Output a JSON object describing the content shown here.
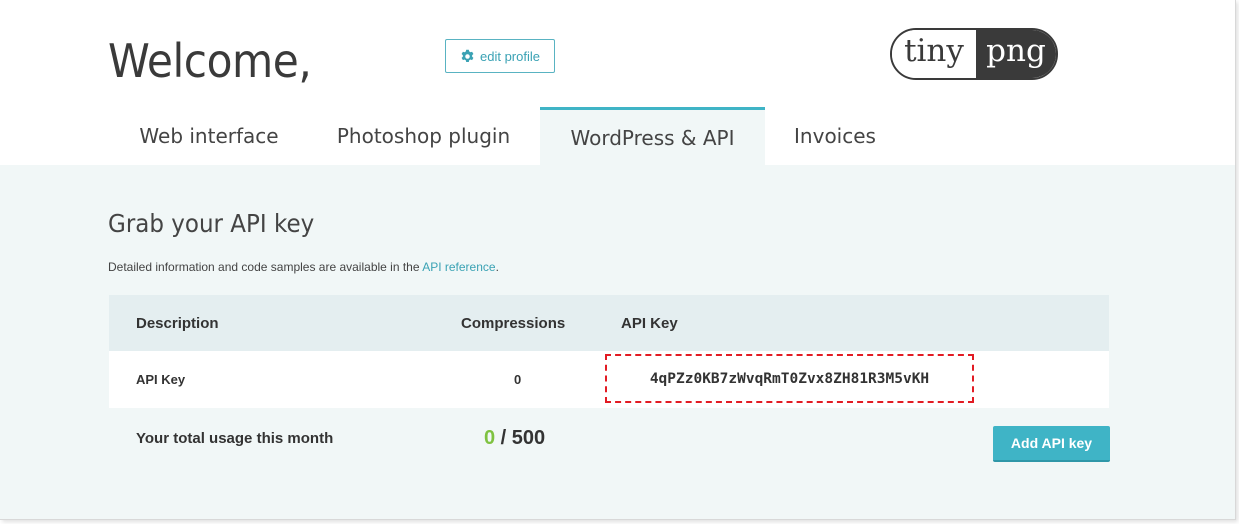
{
  "header": {
    "welcome": "Welcome,",
    "edit_profile_label": "edit profile",
    "logo": {
      "left": "tiny",
      "right": "png"
    }
  },
  "tabs": [
    {
      "label": "Web interface",
      "active": false
    },
    {
      "label": "Photoshop plugin",
      "active": false
    },
    {
      "label": "WordPress & API",
      "active": true
    },
    {
      "label": "Invoices",
      "active": false
    }
  ],
  "section": {
    "title": "Grab your API key",
    "description_prefix": "Detailed information and code samples are available in the ",
    "description_link": "API reference",
    "description_suffix": "."
  },
  "table": {
    "headers": [
      "Description",
      "Compressions",
      "API Key"
    ],
    "rows": [
      {
        "description": "API Key",
        "compressions": "0",
        "api_key": "4qPZz0KB7zWvqRmT0Zvx8ZH81R3M5vKH"
      }
    ]
  },
  "usage": {
    "label": "Your total usage this month",
    "used": "0",
    "separator": " / ",
    "limit": "500"
  },
  "add_api_key_label": "Add API key",
  "colors": {
    "accent": "#3fb4c6",
    "highlight_border": "#e21b23",
    "usage_green": "#7fc241",
    "content_bg": "#f1f7f7"
  },
  "icons": {
    "edit_profile": "gear-icon"
  }
}
